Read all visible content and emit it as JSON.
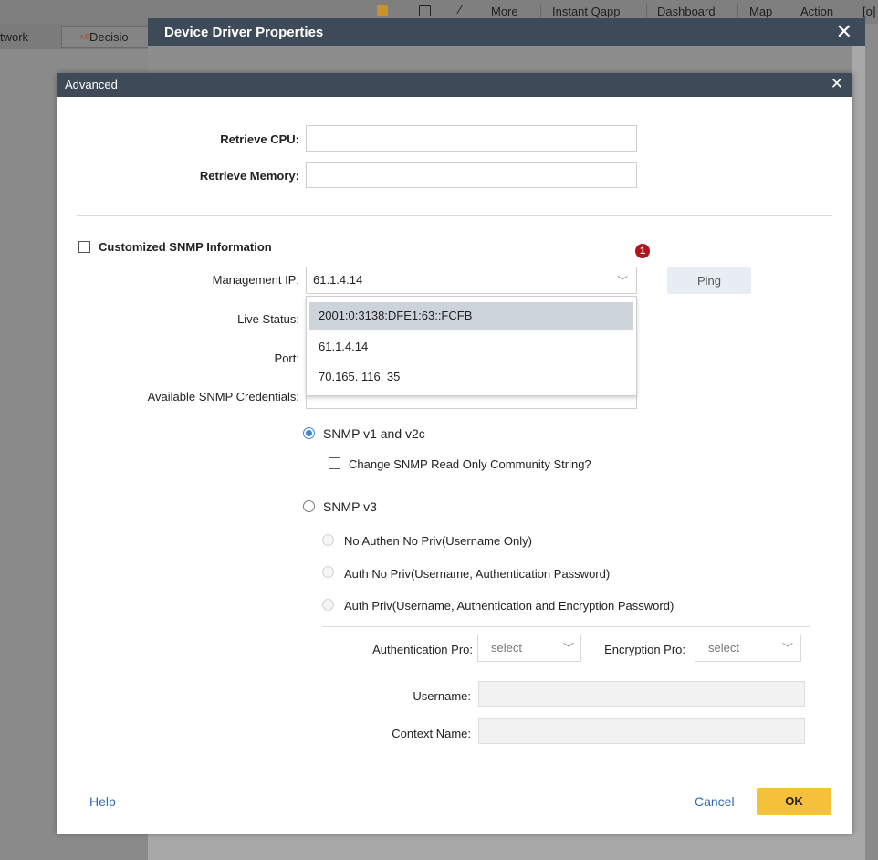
{
  "background_toolbar": {
    "more": "More",
    "instant_qapp": "Instant Qapp",
    "dashboard": "Dashboard",
    "map": "Map",
    "action": "Action",
    "network_tab": "twork",
    "decision_tab": "Decisio"
  },
  "outer_dialog": {
    "title": "Device Driver Properties",
    "close": "✕"
  },
  "modal": {
    "title": "Advanced",
    "close": "✕",
    "retrieve_cpu_label": "Retrieve CPU:",
    "retrieve_memory_label": "Retrieve Memory:",
    "customized_snmp_label": "Customized SNMP Information",
    "badge": "1",
    "management_ip_label": "Management IP:",
    "management_ip_value": "61.1.4.14",
    "ping_label": "Ping",
    "live_status_label": "Live Status:",
    "port_label": "Port:",
    "available_credentials_label": "Available SNMP Credentials:",
    "ip_options": [
      "2001:0:3138:DFE1:63::FCFB",
      "61.1.4.14",
      "70.165. 116. 35"
    ],
    "snmp_v1v2_label": "SNMP v1 and v2c",
    "change_community_label": "Change SNMP Read Only Community String?",
    "snmp_v3_label": "SNMP v3",
    "v3_options": [
      "No Authen No Priv(Username Only)",
      "Auth No Priv(Username, Authentication Password)",
      "Auth Priv(Username, Authentication and Encryption Password)"
    ],
    "auth_pro_label": "Authentication Pro:",
    "auth_pro_value": "select",
    "enc_pro_label": "Encryption Pro:",
    "enc_pro_value": "select",
    "username_label": "Username:",
    "context_name_label": "Context Name:",
    "help_label": "Help",
    "cancel_label": "Cancel",
    "ok_label": "OK"
  },
  "colors": {
    "title_bar": "#3e4a57",
    "ok_button": "#f5c13a",
    "badge": "#b0151c",
    "link": "#2f6bb3"
  }
}
